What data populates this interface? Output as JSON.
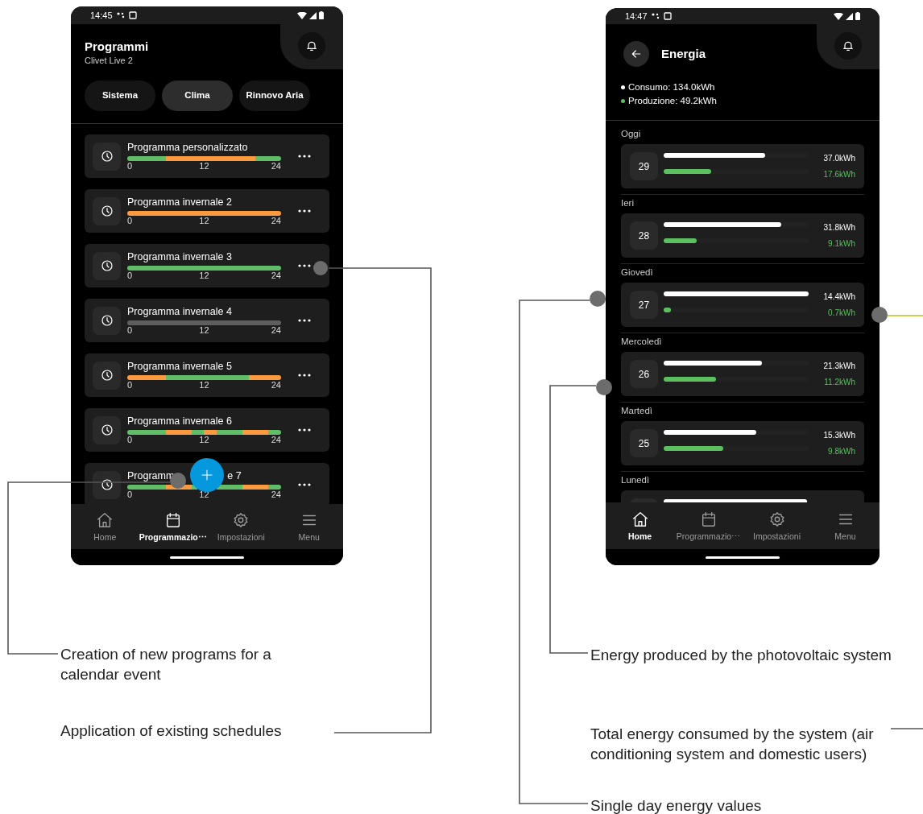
{
  "programs_screen": {
    "status_time": "14:45",
    "title": "Programmi",
    "subtitle": "Clivet Live 2",
    "tabs": [
      {
        "label": "Sistema",
        "selected": false
      },
      {
        "label": "Clima",
        "selected": true
      },
      {
        "label": "Rinnovo Aria",
        "selected": false
      }
    ],
    "programs": [
      {
        "name": "Programma personalizzato",
        "scale": [
          "0",
          "12",
          "24"
        ],
        "hours": [
          {
            "color": "#62bd69"
          },
          {
            "color": "#62bd69"
          },
          {
            "color": "#62bd69"
          },
          {
            "color": "#62bd69"
          },
          {
            "color": "#62bd69"
          },
          {
            "color": "#62bd69"
          },
          {
            "color": "#fb9a3f"
          },
          {
            "color": "#fb9a3f"
          },
          {
            "color": "#fb9a3f"
          },
          {
            "color": "#fb9a3f"
          },
          {
            "color": "#fb9a3f"
          },
          {
            "color": "#fb9a3f"
          },
          {
            "color": "#fb9a3f"
          },
          {
            "color": "#fb9a3f"
          },
          {
            "color": "#fb9a3f"
          },
          {
            "color": "#fb9a3f"
          },
          {
            "color": "#fb9a3f"
          },
          {
            "color": "#fb9a3f"
          },
          {
            "color": "#fb9a3f"
          },
          {
            "color": "#fb9a3f"
          },
          {
            "color": "#62bd69"
          },
          {
            "color": "#62bd69"
          },
          {
            "color": "#62bd69"
          },
          {
            "color": "#62bd69"
          }
        ]
      },
      {
        "name": "Programma invernale 2",
        "scale": [
          "0",
          "12",
          "24"
        ],
        "hours": [
          {
            "color": "#fb9a3f"
          },
          {
            "color": "#fb9a3f"
          },
          {
            "color": "#fb9a3f"
          },
          {
            "color": "#fb9a3f"
          },
          {
            "color": "#fb9a3f"
          },
          {
            "color": "#fb9a3f"
          },
          {
            "color": "#fb9a3f"
          },
          {
            "color": "#fb9a3f"
          },
          {
            "color": "#fb9a3f"
          },
          {
            "color": "#fb9a3f"
          },
          {
            "color": "#fb9a3f"
          },
          {
            "color": "#fb9a3f"
          },
          {
            "color": "#fb9a3f"
          },
          {
            "color": "#fb9a3f"
          },
          {
            "color": "#fb9a3f"
          },
          {
            "color": "#fb9a3f"
          },
          {
            "color": "#fb9a3f"
          },
          {
            "color": "#fb9a3f"
          },
          {
            "color": "#fb9a3f"
          },
          {
            "color": "#fb9a3f"
          },
          {
            "color": "#fb9a3f"
          },
          {
            "color": "#fb9a3f"
          },
          {
            "color": "#fb9a3f"
          },
          {
            "color": "#fb9a3f"
          }
        ]
      },
      {
        "name": "Programma invernale 3",
        "scale": [
          "0",
          "12",
          "24"
        ],
        "hours": [
          {
            "color": "#62bd69"
          },
          {
            "color": "#62bd69"
          },
          {
            "color": "#62bd69"
          },
          {
            "color": "#62bd69"
          },
          {
            "color": "#62bd69"
          },
          {
            "color": "#62bd69"
          },
          {
            "color": "#62bd69"
          },
          {
            "color": "#62bd69"
          },
          {
            "color": "#62bd69"
          },
          {
            "color": "#62bd69"
          },
          {
            "color": "#62bd69"
          },
          {
            "color": "#62bd69"
          },
          {
            "color": "#62bd69"
          },
          {
            "color": "#62bd69"
          },
          {
            "color": "#62bd69"
          },
          {
            "color": "#62bd69"
          },
          {
            "color": "#62bd69"
          },
          {
            "color": "#62bd69"
          },
          {
            "color": "#62bd69"
          },
          {
            "color": "#62bd69"
          },
          {
            "color": "#62bd69"
          },
          {
            "color": "#62bd69"
          },
          {
            "color": "#62bd69"
          },
          {
            "color": "#62bd69"
          }
        ]
      },
      {
        "name": "Programma invernale 4",
        "scale": [
          "0",
          "12",
          "24"
        ],
        "hours": [
          {
            "color": "#5e5e5e"
          },
          {
            "color": "#5e5e5e"
          },
          {
            "color": "#5e5e5e"
          },
          {
            "color": "#5e5e5e"
          },
          {
            "color": "#5e5e5e"
          },
          {
            "color": "#5e5e5e"
          },
          {
            "color": "#5e5e5e"
          },
          {
            "color": "#5e5e5e"
          },
          {
            "color": "#5e5e5e"
          },
          {
            "color": "#5e5e5e"
          },
          {
            "color": "#5e5e5e"
          },
          {
            "color": "#5e5e5e"
          },
          {
            "color": "#5e5e5e"
          },
          {
            "color": "#5e5e5e"
          },
          {
            "color": "#5e5e5e"
          },
          {
            "color": "#5e5e5e"
          },
          {
            "color": "#5e5e5e"
          },
          {
            "color": "#5e5e5e"
          },
          {
            "color": "#5e5e5e"
          },
          {
            "color": "#5e5e5e"
          },
          {
            "color": "#5e5e5e"
          },
          {
            "color": "#5e5e5e"
          },
          {
            "color": "#5e5e5e"
          },
          {
            "color": "#5e5e5e"
          }
        ]
      },
      {
        "name": "Programma invernale 5",
        "scale": [
          "0",
          "12",
          "24"
        ],
        "hours": [
          {
            "color": "#fb9a3f"
          },
          {
            "color": "#fb9a3f"
          },
          {
            "color": "#fb9a3f"
          },
          {
            "color": "#fb9a3f"
          },
          {
            "color": "#fb9a3f"
          },
          {
            "color": "#fb9a3f"
          },
          {
            "color": "#62bd69"
          },
          {
            "color": "#62bd69"
          },
          {
            "color": "#62bd69"
          },
          {
            "color": "#62bd69"
          },
          {
            "color": "#62bd69"
          },
          {
            "color": "#62bd69"
          },
          {
            "color": "#62bd69"
          },
          {
            "color": "#62bd69"
          },
          {
            "color": "#62bd69"
          },
          {
            "color": "#62bd69"
          },
          {
            "color": "#62bd69"
          },
          {
            "color": "#62bd69"
          },
          {
            "color": "#62bd69"
          },
          {
            "color": "#fb9a3f"
          },
          {
            "color": "#fb9a3f"
          },
          {
            "color": "#fb9a3f"
          },
          {
            "color": "#fb9a3f"
          },
          {
            "color": "#fb9a3f"
          }
        ]
      },
      {
        "name": "Programma invernale 6",
        "scale": [
          "0",
          "12",
          "24"
        ],
        "hours": [
          {
            "color": "#62bd69"
          },
          {
            "color": "#62bd69"
          },
          {
            "color": "#62bd69"
          },
          {
            "color": "#62bd69"
          },
          {
            "color": "#62bd69"
          },
          {
            "color": "#62bd69"
          },
          {
            "color": "#fb9a3f"
          },
          {
            "color": "#fb9a3f"
          },
          {
            "color": "#fb9a3f"
          },
          {
            "color": "#fb9a3f"
          },
          {
            "color": "#62bd69"
          },
          {
            "color": "#62bd69"
          },
          {
            "color": "#fb9a3f"
          },
          {
            "color": "#fb9a3f"
          },
          {
            "color": "#62bd69"
          },
          {
            "color": "#62bd69"
          },
          {
            "color": "#62bd69"
          },
          {
            "color": "#62bd69"
          },
          {
            "color": "#fb9a3f"
          },
          {
            "color": "#fb9a3f"
          },
          {
            "color": "#fb9a3f"
          },
          {
            "color": "#fb9a3f"
          },
          {
            "color": "#62bd69"
          },
          {
            "color": "#62bd69"
          }
        ]
      },
      {
        "name_parts": [
          "Programm",
          "e 7"
        ],
        "scale": [
          "0",
          "12",
          "24"
        ],
        "hours": [
          {
            "color": "#62bd69"
          },
          {
            "color": "#62bd69"
          },
          {
            "color": "#62bd69"
          },
          {
            "color": "#62bd69"
          },
          {
            "color": "#62bd69"
          },
          {
            "color": "#62bd69"
          },
          {
            "color": "#fb9a3f"
          },
          {
            "color": "#fb9a3f"
          },
          {
            "color": "#fb9a3f"
          },
          {
            "color": "#fb9a3f"
          },
          {
            "color": "#62bd69"
          }
        ],
        "hours_after_cover": [
          {
            "color": "#62bd69"
          },
          {
            "color": "#62bd69"
          },
          {
            "color": "#62bd69"
          },
          {
            "color": "#62bd69"
          },
          {
            "color": "#fb9a3f"
          },
          {
            "color": "#fb9a3f"
          },
          {
            "color": "#fb9a3f"
          },
          {
            "color": "#fb9a3f"
          },
          {
            "color": "#62bd69"
          },
          {
            "color": "#62bd69"
          }
        ]
      }
    ],
    "nav": [
      {
        "label": "Home",
        "selected": false
      },
      {
        "label": "Programmazio⋯",
        "selected": true
      },
      {
        "label": "Impostazioni",
        "selected": false
      },
      {
        "label": "Menu",
        "selected": false
      }
    ]
  },
  "energy_screen": {
    "status_time": "14:47",
    "title": "Energia",
    "legend": [
      {
        "text": "Consumo: 134.0kWh",
        "color": "#ffffff"
      },
      {
        "text": "Produzione: 49.2kWh",
        "color": "#5cbf60"
      }
    ],
    "days": [
      {
        "label": "Oggi",
        "day": "29",
        "consumption": {
          "level": 0.7,
          "value": "37.0kWh"
        },
        "production": {
          "level": 0.33,
          "value": "17.6kWh"
        }
      },
      {
        "label": "Ieri",
        "day": "28",
        "consumption": {
          "level": 0.81,
          "value": "31.8kWh"
        },
        "production": {
          "level": 0.23,
          "value": "9.1kWh"
        }
      },
      {
        "label": "Giovedì",
        "day": "27",
        "consumption": {
          "level": 1,
          "value": "14.4kWh"
        },
        "production": {
          "level": 0.05,
          "value": "0.7kWh"
        }
      },
      {
        "label": "Mercoledì",
        "day": "26",
        "consumption": {
          "level": 0.68,
          "value": "21.3kWh"
        },
        "production": {
          "level": 0.36,
          "value": "11.2kWh"
        }
      },
      {
        "label": "Martedì",
        "day": "25",
        "consumption": {
          "level": 0.64,
          "value": "15.3kWh"
        },
        "production": {
          "level": 0.41,
          "value": "9.8kWh"
        }
      },
      {
        "label": "Lunedì",
        "consumption": {
          "level": 0.99
        }
      }
    ],
    "nav": [
      {
        "label": "Home",
        "selected": true
      },
      {
        "label": "Programmazio⋯",
        "selected": false
      },
      {
        "label": "Impostazioni",
        "selected": false
      },
      {
        "label": "Menu",
        "selected": false
      }
    ]
  },
  "annotations": [
    {
      "text": "Creation of new programs for a calendar event"
    },
    {
      "text": "Application of existing schedules"
    },
    {
      "text": "Energy produced by the photovoltaic system"
    },
    {
      "text": "Total energy consumed by the system (air conditioning system and domestic users)"
    },
    {
      "text": "Single day energy values"
    }
  ]
}
